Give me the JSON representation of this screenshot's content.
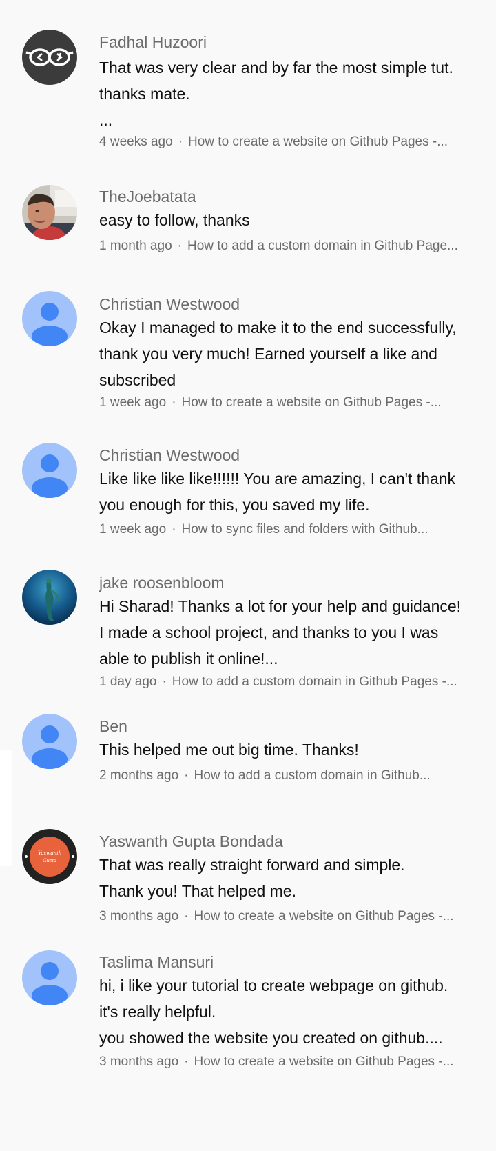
{
  "separator": "·",
  "comments": [
    {
      "author": "Fadhal Huzoori",
      "lines": [
        "That was very clear and by far the most simple tut.",
        "thanks mate.",
        "..."
      ],
      "time": "4 weeks ago",
      "video": "How to create a website on Github Pages -...",
      "avatar": {
        "type": "glasses",
        "bg": "#3b3b3b"
      }
    },
    {
      "author": "TheJoebatata",
      "lines": [
        "easy to follow, thanks"
      ],
      "time": "1 month ago",
      "video": "How to add a custom domain in Github Page...",
      "avatar": {
        "type": "photo-person",
        "bg": "#b9b6b0"
      }
    },
    {
      "author": "Christian Westwood",
      "lines": [
        "Okay I managed to make it to the end successfully,",
        "thank you very much! Earned yourself a like and",
        "subscribed"
      ],
      "time": "1 week ago",
      "video": "How to create a website on Github Pages -...",
      "avatar": {
        "type": "default-user",
        "bg": "#a1c2fa",
        "fg": "#4285f4"
      }
    },
    {
      "author": "Christian Westwood",
      "lines": [
        "Like like like like!!!!!! You are amazing, I can't thank",
        "you enough for this, you saved my life."
      ],
      "time": "1 week ago",
      "video": "How to sync files and folders with Github...",
      "avatar": {
        "type": "default-user",
        "bg": "#a1c2fa",
        "fg": "#4285f4"
      }
    },
    {
      "author": "jake roosenbloom",
      "lines": [
        "Hi Sharad! Thanks a lot for your help and guidance!",
        "I made a school project, and thanks to you I was",
        "able to publish it online!..."
      ],
      "time": "1 day ago",
      "video": "How to add a custom domain in Github Pages -...",
      "avatar": {
        "type": "photo-underwater",
        "bg": "#0d3e6e"
      }
    },
    {
      "author": "Ben",
      "lines": [
        "This helped me out big time. Thanks!"
      ],
      "time": "2 months ago",
      "video": "How to add a custom domain in Github...",
      "avatar": {
        "type": "default-user",
        "bg": "#a1c2fa",
        "fg": "#4285f4"
      }
    },
    {
      "author": "Yaswanth Gupta Bondada",
      "lines": [
        "That was really straight forward and simple.",
        "Thank you! That helped me."
      ],
      "time": "3 months ago",
      "video": "How to create a website on Github Pages -...",
      "avatar": {
        "type": "logo",
        "bg": "#222222",
        "fg": "#e8623c",
        "logo_text": [
          "Yaswanth",
          "Gupta"
        ]
      }
    },
    {
      "author": "Taslima Mansuri",
      "lines": [
        "hi, i like your tutorial to create webpage on github.",
        "it's really helpful.",
        "you showed the website you created on github...."
      ],
      "time": "3 months ago",
      "video": "How to create a website on Github Pages -...",
      "avatar": {
        "type": "default-user",
        "bg": "#a1c2fa",
        "fg": "#4285f4"
      }
    }
  ]
}
